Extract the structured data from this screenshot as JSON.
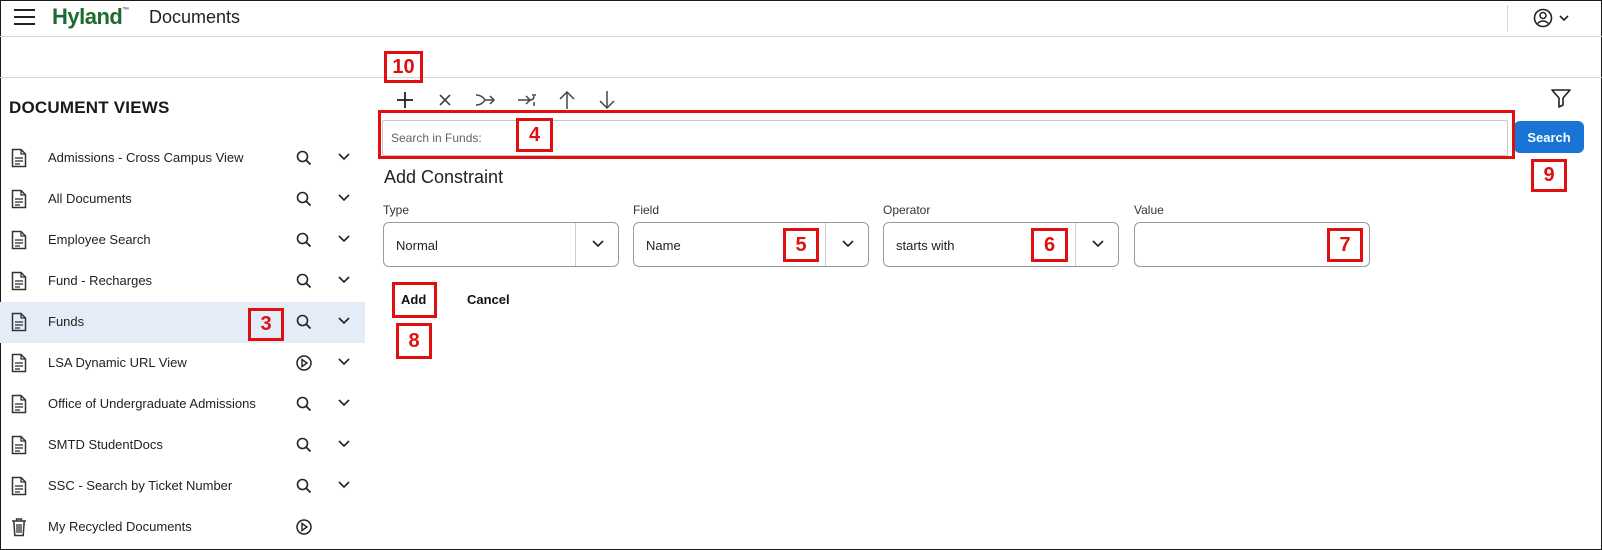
{
  "header": {
    "logo": "Hyland",
    "logo_mark": "™",
    "title": "Documents"
  },
  "sidebar": {
    "title": "DOCUMENT VIEWS",
    "items": [
      {
        "label": "Admissions - Cross Campus View",
        "icon": "document-icon",
        "action_icon": "search-icon",
        "selected": false
      },
      {
        "label": "All Documents",
        "icon": "document-icon",
        "action_icon": "search-icon",
        "selected": false
      },
      {
        "label": "Employee Search",
        "icon": "document-icon",
        "action_icon": "search-icon",
        "selected": false
      },
      {
        "label": "Fund - Recharges",
        "icon": "document-icon",
        "action_icon": "search-icon",
        "selected": false
      },
      {
        "label": "Funds",
        "icon": "document-icon",
        "action_icon": "search-icon",
        "selected": true
      },
      {
        "label": "LSA Dynamic URL View",
        "icon": "document-icon",
        "action_icon": "play-icon",
        "selected": false
      },
      {
        "label": "Office of Undergraduate Admissions",
        "icon": "document-icon",
        "action_icon": "search-icon",
        "selected": false
      },
      {
        "label": "SMTD StudentDocs",
        "icon": "document-icon",
        "action_icon": "search-icon",
        "selected": false
      },
      {
        "label": "SSC - Search by Ticket Number",
        "icon": "document-icon",
        "action_icon": "search-icon",
        "selected": false
      },
      {
        "label": "My Recycled Documents",
        "icon": "trash-icon",
        "action_icon": "play-icon",
        "selected": false
      }
    ]
  },
  "toolbar": {
    "icons": [
      "plus-icon",
      "close-icon",
      "merge-icon",
      "indent-icon",
      "arrow-up-icon",
      "arrow-down-icon"
    ],
    "filter_icon": "filter-icon"
  },
  "search": {
    "placeholder": "Search in Funds:",
    "value": "",
    "button_label": "Search"
  },
  "constraint": {
    "title": "Add Constraint",
    "type_label": "Type",
    "type_value": "Normal",
    "field_label": "Field",
    "field_value": "Name",
    "operator_label": "Operator",
    "operator_value": "starts with",
    "value_label": "Value",
    "value_value": "",
    "add_label": "Add",
    "cancel_label": "Cancel"
  },
  "annotations": {
    "a3": "3",
    "a4": "4",
    "a5": "5",
    "a6": "6",
    "a7": "7",
    "a8": "8",
    "a9": "9",
    "a10": "10"
  },
  "colors": {
    "brand": "#1f6b2f",
    "primary": "#1875d6",
    "selected_bg": "#e4edf7",
    "annotation": "#e01010"
  }
}
